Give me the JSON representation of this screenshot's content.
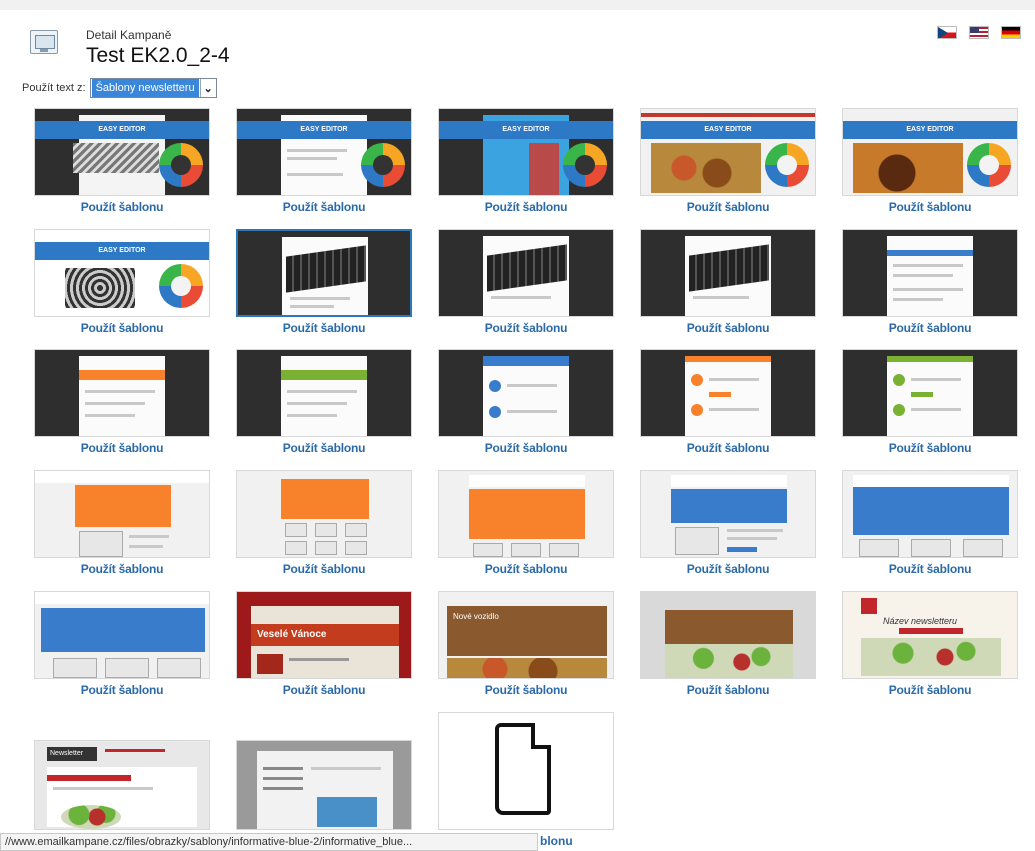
{
  "header": {
    "subtitle": "Detail Kampaně",
    "title": "Test EK2.0_2-4"
  },
  "languages": [
    {
      "code": "cz",
      "icon": "czech-flag-icon"
    },
    {
      "code": "en",
      "icon": "us-flag-icon"
    },
    {
      "code": "de",
      "icon": "german-flag-icon"
    }
  ],
  "use_text": {
    "label": "Použít text z:",
    "selected": "Šablony newsletteru"
  },
  "templates": {
    "link_label": "Použít šablonu",
    "items": [
      {
        "banner": "EASY EDITOR"
      },
      {
        "banner": "EASY EDITOR"
      },
      {
        "banner": "EASY EDITOR"
      },
      {
        "banner": "EASY EDITOR"
      },
      {
        "banner": "EASY EDITOR"
      },
      {
        "banner": "EASY EDITOR"
      },
      {},
      {},
      {},
      {},
      {},
      {},
      {},
      {},
      {},
      {},
      {},
      {},
      {},
      {},
      {},
      {
        "banner": "Veselé Vánoce"
      },
      {
        "banner": "Nové vozidlo"
      },
      {},
      {
        "banner": "Název newsletteru"
      },
      {
        "banner": "Newsletter"
      },
      {},
      {}
    ]
  },
  "statusbar": {
    "url": "//www.emailkampane.cz/files/obrazky/sablony/informative-blue-2/informative_blue...",
    "partial_link": "blonu"
  }
}
